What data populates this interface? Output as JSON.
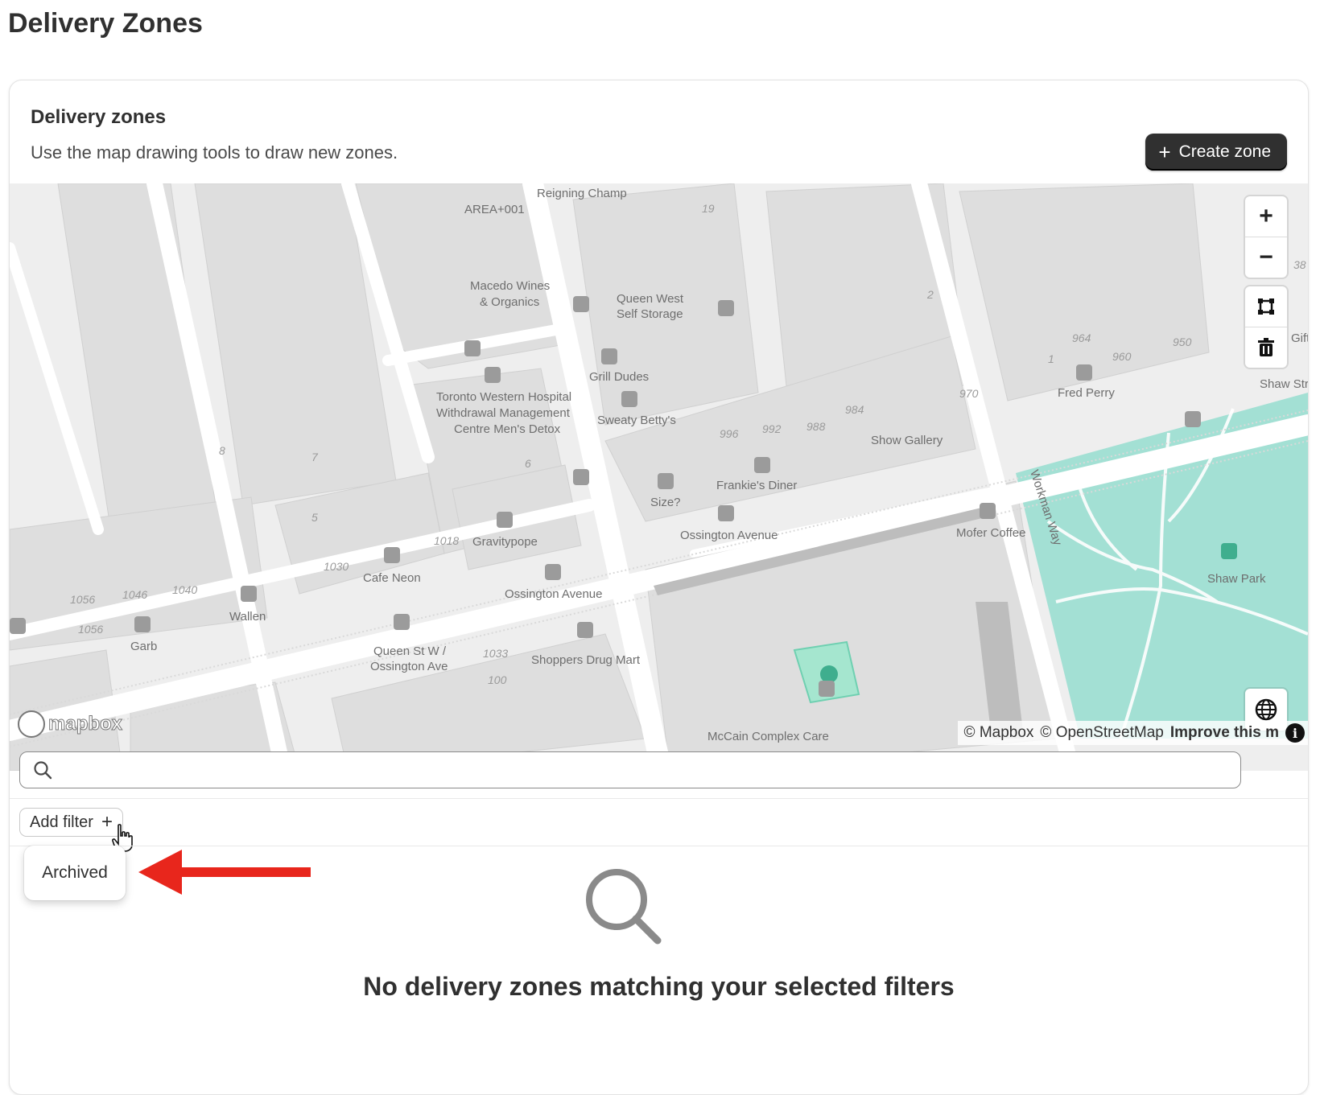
{
  "page": {
    "title": "Delivery Zones"
  },
  "card": {
    "title": "Delivery zones",
    "subtitle": "Use the map drawing tools to draw new zones.",
    "create_button": "Create zone"
  },
  "map": {
    "labels": [
      "Reigning Champ",
      "AREA+001",
      "Macedo Wines",
      "& Organics",
      "Queen West",
      "Self Storage",
      "Grill Dudes",
      "Sweaty Betty's",
      "Toronto Western Hospital",
      "Withdrawal Management",
      "Centre Men's Detox",
      "Fred Perry",
      "Shaw Stre",
      "Show Gallery",
      "Frankie's Diner",
      "Size?",
      "Ossington Avenue",
      "Mofer Coffee",
      "Workman Way",
      "Shaw Park",
      "Gravitypope",
      "Cafe Neon",
      "Ossington Avenue",
      "Wallen",
      "Garb",
      "Queen St W /",
      "Ossington Ave",
      "Shoppers Drug Mart",
      "McCain Complex Care",
      "Gifts"
    ],
    "numbers": [
      "19",
      "2",
      "964",
      "960",
      "950",
      "1",
      "970",
      "984",
      "996",
      "992",
      "988",
      "6",
      "5",
      "1018",
      "1030",
      "1040",
      "1046",
      "1056",
      "1056",
      "1033",
      "100",
      "8",
      "7",
      "38"
    ],
    "controls": [
      "zoom-in",
      "zoom-out",
      "draw-polygon",
      "trash",
      "globe"
    ],
    "logo": "mapbox",
    "attribution": {
      "mapbox": "© Mapbox",
      "osm": "© OpenStreetMap",
      "improve": "Improve this m",
      "info": "i"
    },
    "colors": {
      "park": "#a3e0d4",
      "zone": "#a5e6cf",
      "road": "#ffffff",
      "block": "#dddddd"
    }
  },
  "search": {
    "value": "",
    "placeholder": ""
  },
  "filters": {
    "add_label": "Add filter",
    "options": [
      "Archived"
    ]
  },
  "empty_state": {
    "message": "No delivery zones matching your selected filters"
  },
  "annotation": {
    "arrow_color": "#e8261c"
  }
}
